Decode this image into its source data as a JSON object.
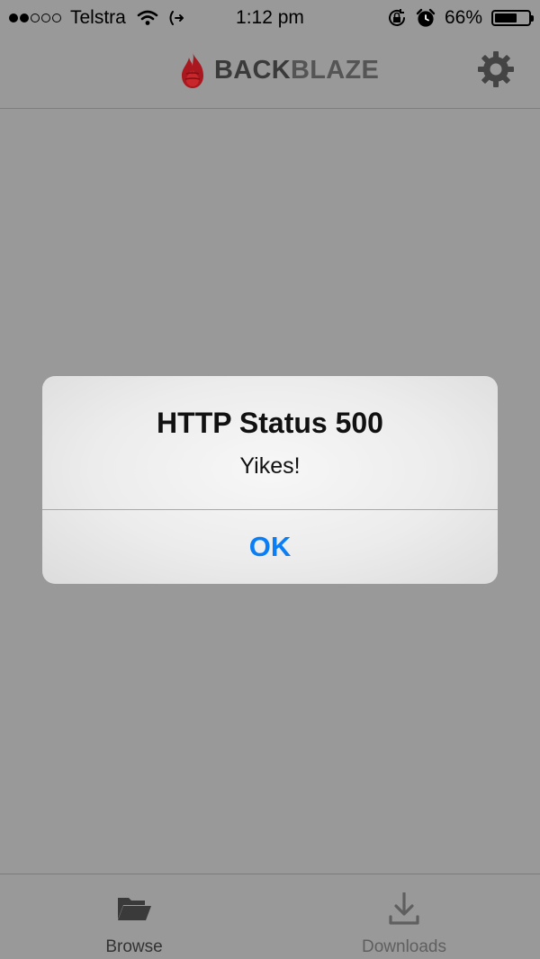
{
  "status_bar": {
    "signal_full": 2,
    "signal_total": 5,
    "carrier": "Telstra",
    "time": "1:12 pm",
    "battery_text": "66%",
    "battery_level": 0.66
  },
  "nav": {
    "logo_part1": "BACK",
    "logo_part2": "BLAZE",
    "settings_icon": "gear-icon"
  },
  "alert": {
    "title": "HTTP Status 500",
    "message": "Yikes!",
    "ok_label": "OK",
    "ok_color": "#0a7ff5"
  },
  "tabs": [
    {
      "label": "Browse",
      "icon": "folder-icon"
    },
    {
      "label": "Downloads",
      "icon": "download-icon"
    }
  ],
  "colors": {
    "background": "#999999",
    "brand_red": "#a8181e"
  }
}
